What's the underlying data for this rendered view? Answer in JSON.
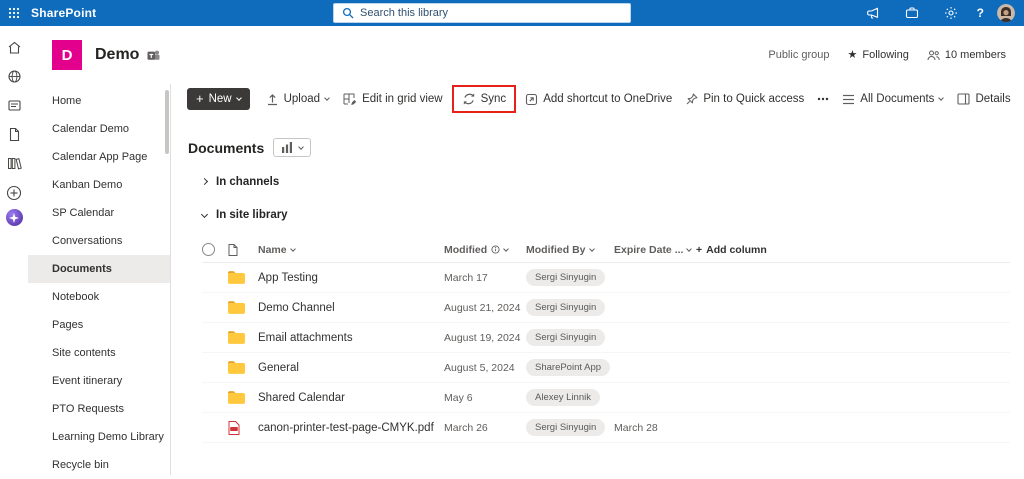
{
  "suite_bar": {
    "app_name": "SharePoint",
    "search_placeholder": "Search this library",
    "help_label": "?"
  },
  "site_header": {
    "logo_letter": "D",
    "title": "Demo",
    "privacy": "Public group",
    "following": "Following",
    "members": "10 members"
  },
  "sidebar": {
    "items": [
      "Home",
      "Calendar Demo",
      "Calendar App Page",
      "Kanban Demo",
      "SP Calendar",
      "Conversations",
      "Documents",
      "Notebook",
      "Pages",
      "Site contents",
      "Event itinerary",
      "PTO Requests",
      "Learning Demo Library",
      "Recycle bin"
    ],
    "selected": "Documents"
  },
  "command_bar": {
    "new": "New",
    "upload": "Upload",
    "edit_grid": "Edit in grid view",
    "sync": "Sync",
    "add_shortcut": "Add shortcut to OneDrive",
    "pin": "Pin to Quick access",
    "view": "All Documents",
    "details": "Details"
  },
  "library": {
    "title": "Documents",
    "sections": [
      {
        "label": "In channels",
        "expanded": false
      },
      {
        "label": "In site library",
        "expanded": true
      }
    ],
    "table": {
      "headers": {
        "name": "Name",
        "modified": "Modified",
        "modified_by": "Modified By",
        "expire": "Expire Date ...",
        "add_column": "Add column"
      },
      "rows": [
        {
          "type": "folder",
          "name": "App Testing",
          "modified": "March 17",
          "modified_by": "Sergi Sinyugin",
          "expire": ""
        },
        {
          "type": "folder",
          "name": "Demo Channel",
          "modified": "August 21, 2024",
          "modified_by": "Sergi Sinyugin",
          "expire": ""
        },
        {
          "type": "folder",
          "name": "Email attachments",
          "modified": "August 19, 2024",
          "modified_by": "Sergi Sinyugin",
          "expire": ""
        },
        {
          "type": "folder",
          "name": "General",
          "modified": "August 5, 2024",
          "modified_by": "SharePoint App",
          "expire": ""
        },
        {
          "type": "folder",
          "name": "Shared Calendar",
          "modified": "May 6",
          "modified_by": "Alexey Linnik",
          "expire": ""
        },
        {
          "type": "pdf",
          "name": "canon-printer-test-page-CMYK.pdf",
          "modified": "March 26",
          "modified_by": "Sergi Sinyugin",
          "expire": "March 28"
        }
      ]
    }
  },
  "colors": {
    "suite_bar": "#0f6cbd",
    "site_logo": "#e3008c",
    "annotation_box": "#e62117",
    "folder": "#ffc83d",
    "selected_nav": "#edebe9",
    "pill_bg": "#edebe9"
  }
}
